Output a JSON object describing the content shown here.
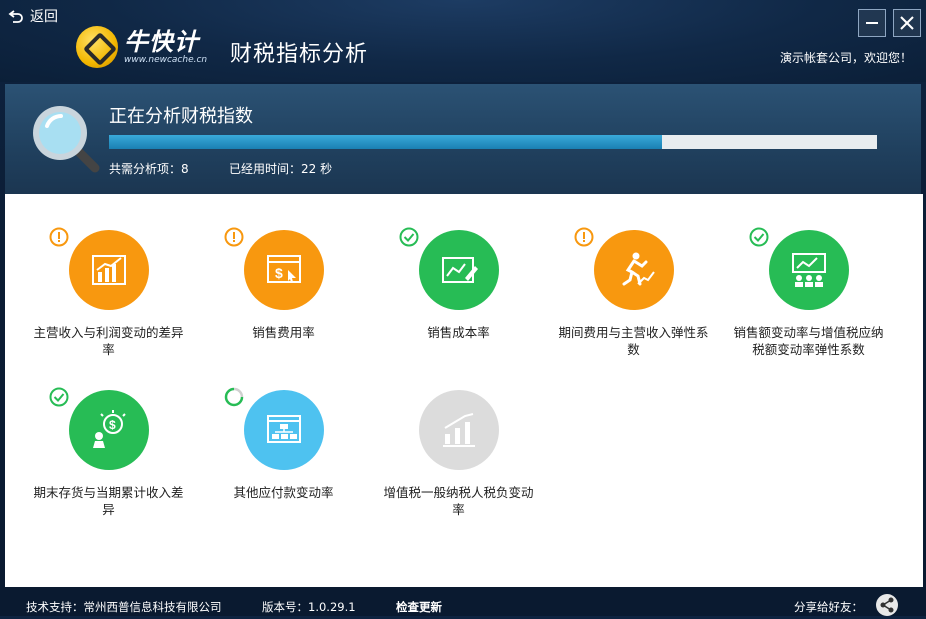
{
  "header": {
    "back_label": "返回",
    "logo_name": "牛快计",
    "logo_url": "www.newcache.cn",
    "title": "财税指标分析",
    "greeting": "演示帐套公司，欢迎您！"
  },
  "scan": {
    "title": "正在分析财税指数",
    "progress": 0.72,
    "total_items": "共需分析项：8",
    "elapsed": "已经用时间：22 秒"
  },
  "items": [
    {
      "label": "主营收入与利润变动的差异率",
      "color": "#f8980f",
      "status": "warning",
      "icon": "bar-chart-icon"
    },
    {
      "label": "销售费用率",
      "color": "#f8980f",
      "status": "warning",
      "icon": "dollar-window-icon"
    },
    {
      "label": "销售成本率",
      "color": "#27bc55",
      "status": "done",
      "icon": "chart-pencil-icon"
    },
    {
      "label": "期间费用与主营收入弹性系数",
      "color": "#f8980f",
      "status": "warning",
      "icon": "running-man-icon"
    },
    {
      "label": "销售额变动率与增值税应纳税额变动率弹性系数",
      "color": "#27bc55",
      "status": "done",
      "icon": "presentation-icon"
    },
    {
      "label": "期末存货与当期累计收入差异",
      "color": "#27bc55",
      "status": "done",
      "icon": "idea-dollar-icon"
    },
    {
      "label": "其他应付款变动率",
      "color": "#4ec2f0",
      "status": "loading",
      "icon": "org-chart-icon"
    },
    {
      "label": "增值税一般纳税人税负变动率",
      "color": "#dcdcdc",
      "status": "pending",
      "icon": "growth-people-icon"
    }
  ],
  "footer": {
    "support": "技术支持：常州西普信息科技有限公司",
    "version": "版本号：1.0.29.1",
    "check_update": "检查更新",
    "share": "分享给好友："
  }
}
